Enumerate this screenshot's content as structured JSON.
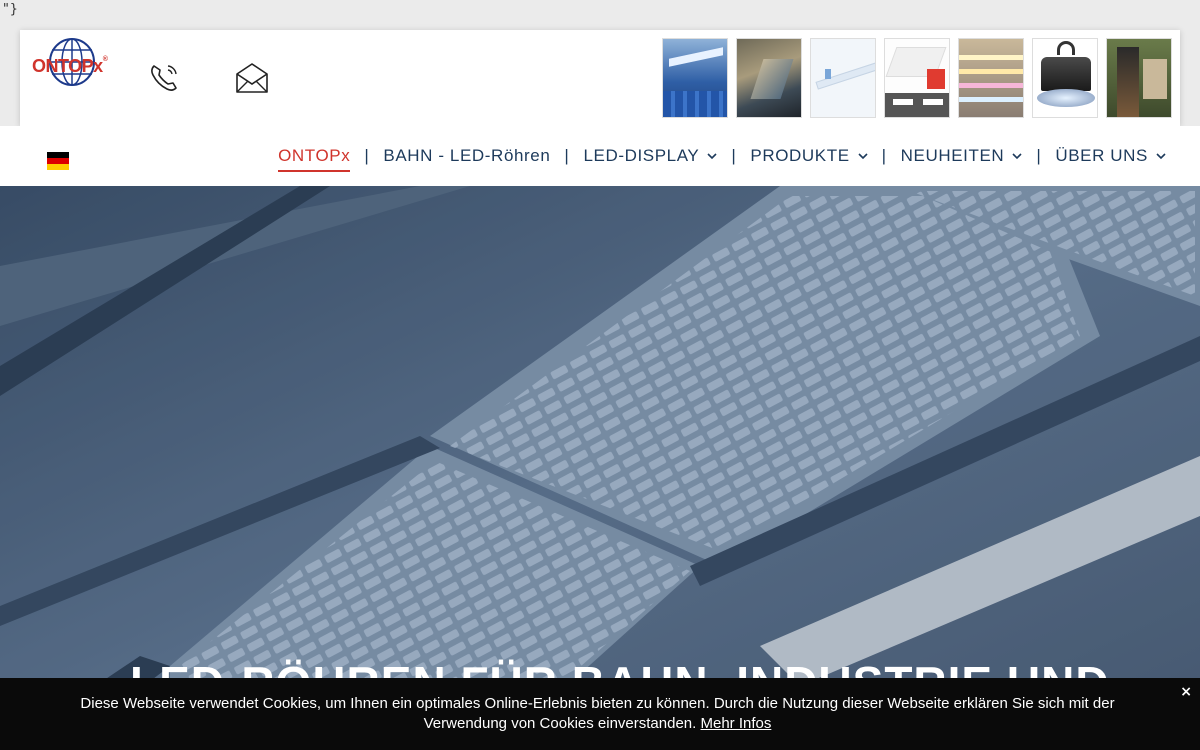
{
  "raw_text": "\"}",
  "header": {
    "logo_text": "ONTOPx",
    "logo_reg": "®",
    "phone_icon": "phone-icon",
    "mail_icon": "envelope-icon",
    "thumbnails": [
      {
        "name": "thumb-train-interior"
      },
      {
        "name": "thumb-led-display-wall"
      },
      {
        "name": "thumb-led-tube"
      },
      {
        "name": "thumb-led-panel"
      },
      {
        "name": "thumb-led-strips"
      },
      {
        "name": "thumb-highbay-lamp"
      },
      {
        "name": "thumb-outdoor-display"
      }
    ]
  },
  "nav": {
    "flag": "germany-flag",
    "items": [
      {
        "label": "ONTOPx",
        "active": true,
        "dropdown": false
      },
      {
        "label": "BAHN - LED-Röhren",
        "active": false,
        "dropdown": false
      },
      {
        "label": "LED-DISPLAY",
        "active": false,
        "dropdown": true
      },
      {
        "label": "PRODUKTE",
        "active": false,
        "dropdown": true
      },
      {
        "label": "NEUHEITEN",
        "active": false,
        "dropdown": true
      },
      {
        "label": "ÜBER UNS",
        "active": false,
        "dropdown": true
      }
    ],
    "separator": "|"
  },
  "hero": {
    "title": "LED-RÖHREN FÜR BAHN, INDUSTRIE UND"
  },
  "cookie": {
    "text": "Diese Webseite verwendet Cookies, um Ihnen ein optimales Online-Erlebnis bieten zu können. Durch die Nutzung dieser Webseite erklären Sie sich mit der Verwendung von Cookies einverstanden.",
    "link_label": "Mehr Infos",
    "close_label": "×"
  },
  "colors": {
    "brand_red": "#d0342c",
    "nav_text": "#1d3a5b"
  }
}
